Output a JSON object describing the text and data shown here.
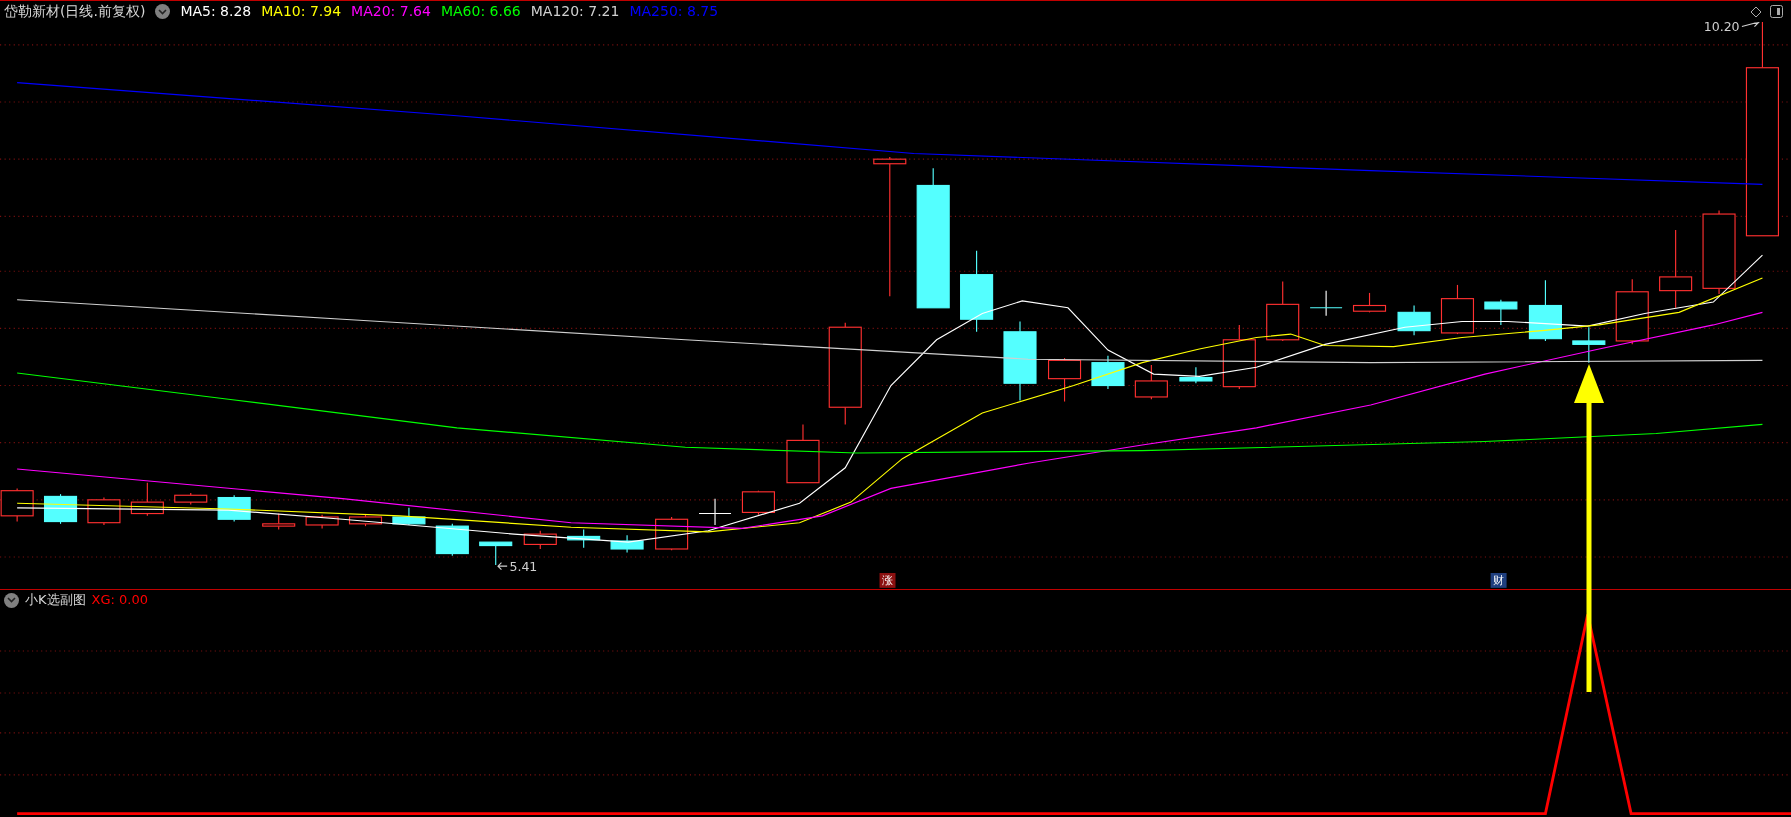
{
  "main_chart": {
    "title": "岱勒新材(日线.前复权)",
    "indicators": [
      {
        "label": "MA5: 8.28",
        "color": "#ffffff"
      },
      {
        "label": "MA10: 7.94",
        "color": "#ffff00"
      },
      {
        "label": "MA20: 7.64",
        "color": "#ff00ff"
      },
      {
        "label": "MA60: 6.66",
        "color": "#00ff00"
      },
      {
        "label": "MA120: 7.21",
        "color": "#d0d0d0"
      },
      {
        "label": "MA250: 8.75",
        "color": "#0000ff"
      }
    ],
    "price_labels": [
      {
        "kind": "high",
        "text": "10.20"
      },
      {
        "kind": "low",
        "text": "5.41"
      }
    ],
    "markers": [
      {
        "text": "涨",
        "color": "#8b1010"
      },
      {
        "text": "财",
        "color": "#1f3f7f"
      }
    ]
  },
  "sub_chart": {
    "title": "小K选副图",
    "indicators": [
      {
        "label": "XG: 0.00",
        "color": "#ff0000"
      }
    ]
  }
}
